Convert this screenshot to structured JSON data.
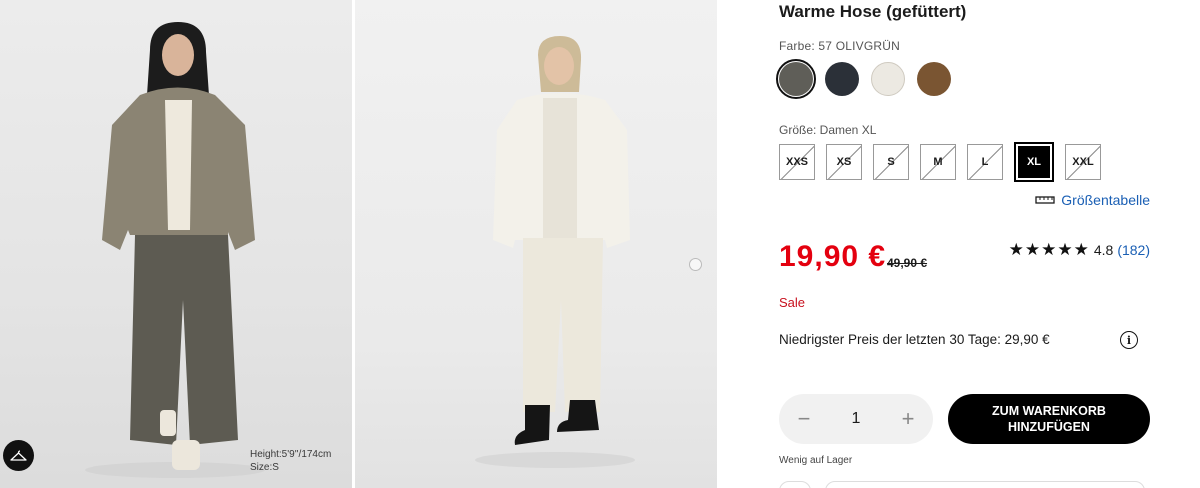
{
  "images": {
    "left": {
      "caption_height": "Height:5'9''/174cm",
      "caption_size": "Size:S"
    },
    "right": {}
  },
  "product": {
    "title": "Warme Hose (gefüttert)",
    "color_label": "Farbe: 57 OLIVGRÜN",
    "colors": [
      {
        "name": "olive",
        "hex": "#5f5e58",
        "selected": true
      },
      {
        "name": "navy",
        "hex": "#2b3038",
        "selected": false
      },
      {
        "name": "off-white",
        "hex": "#ece9e2",
        "selected": false
      },
      {
        "name": "brown",
        "hex": "#7a5532",
        "selected": false
      }
    ],
    "size_label": "Größe: Damen XL",
    "sizes": [
      "XXS",
      "XS",
      "S",
      "M",
      "L",
      "XL",
      "XXL"
    ],
    "selected_size": "XL",
    "size_chart_label": "Größentabelle",
    "price": "19,90 €",
    "old_price": "49,90 €",
    "rating_stars": "★★★★★",
    "rating_value": "4.8",
    "rating_count": "(182)",
    "sale_label": "Sale",
    "lowest_price_text": "Niedrigster Preis der letzten 30 Tage: 29,90 €",
    "quantity": "1",
    "qty_minus": "−",
    "qty_plus": "+",
    "cart_button": "ZUM WARENKORB HINZUFÜGEN",
    "stock_text": "Wenig auf Lager"
  },
  "colors": {
    "sale_red": "#e4000f",
    "link_blue": "#1a5fb4",
    "black": "#000000"
  }
}
